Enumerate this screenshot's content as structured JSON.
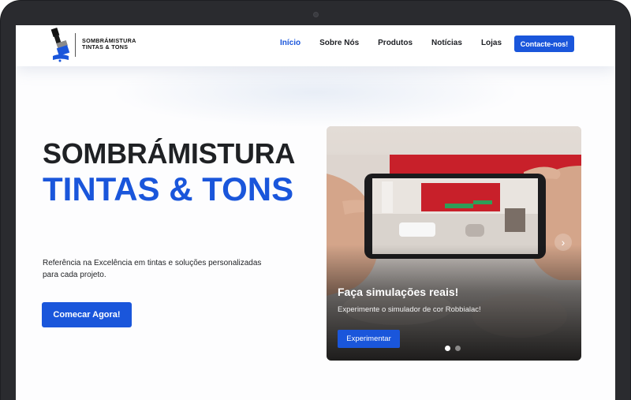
{
  "brand": {
    "line1": "SOMBRÁMISTURA",
    "line2": "TINTAS & TONS",
    "icon": "paint-brush-icon"
  },
  "nav": {
    "items": [
      {
        "label": "Início",
        "active": true
      },
      {
        "label": "Sobre Nós",
        "active": false
      },
      {
        "label": "Produtos",
        "active": false
      },
      {
        "label": "Notícias",
        "active": false
      },
      {
        "label": "Lojas",
        "active": false
      }
    ],
    "contact_label": "Contacte-nos!"
  },
  "hero": {
    "title": "SOMBRÁMISTURA",
    "subtitle": "TINTAS & TONS",
    "description": "Referência na Excelência em tintas e soluções personalizadas para cada projeto.",
    "cta_label": "Comecar Agora!"
  },
  "carousel": {
    "slide_title": "Faça simulações reais!",
    "slide_text": "Experimente o simulador de cor Robbialac!",
    "slide_button": "Experimentar",
    "next_icon": "chevron-right-icon",
    "slide_count": 2,
    "current_slide": 1
  },
  "colors": {
    "accent": "#1a56db",
    "text": "#1f2124",
    "bezel": "#1e1f22"
  }
}
